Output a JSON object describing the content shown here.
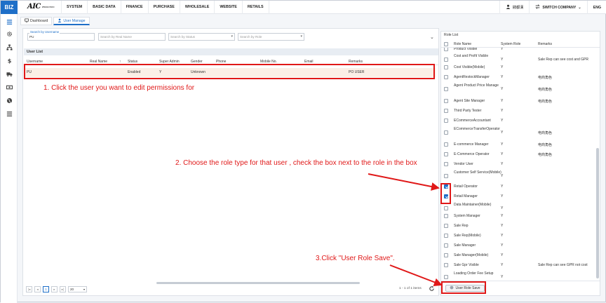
{
  "topbar": {
    "biz": "BIZ",
    "logo": "AIC",
    "logo_sub": "PRODUCTION",
    "menu": [
      "SYSTEM",
      "BASIC DATA",
      "FINANCE",
      "PURCHASE",
      "WHOLESALE",
      "WEBSITE",
      "RETAILS"
    ],
    "user_name": "錢都漢",
    "switch_company": "SWITCH COMPANY",
    "language": "ENG"
  },
  "tabs": [
    "Dashboard",
    "User Manage"
  ],
  "filters": {
    "username_label": "Search by Username",
    "username_value": "PU",
    "real_name_placeholder": "Search by Real Name",
    "status_placeholder": "Search by Status",
    "role_placeholder": "Search by Role"
  },
  "user_list": {
    "title": "User List",
    "columns": [
      "Username",
      "Real Name",
      "Status",
      "Super Admin",
      "Gender",
      "Phone",
      "Mobile No.",
      "Email",
      "Remarks"
    ],
    "sort_icon": "↑",
    "rows": [
      {
        "username": "PU",
        "real_name": "",
        "status": "Enabled",
        "super_admin": "Y",
        "gender": "Unknown",
        "phone": "",
        "mobile": "",
        "email": "",
        "remarks": "PO USER"
      }
    ]
  },
  "pagination": {
    "current_page": "1",
    "page_size": "20",
    "info": "1 - 1 of 1 items"
  },
  "role_list": {
    "title": "Role List",
    "columns": [
      "Role Name",
      "System Role",
      "Remarks"
    ],
    "rows": [
      {
        "name": "Product Visible",
        "sys": "Y",
        "remarks": "",
        "checked": false
      },
      {
        "name": "Cost and Profit Visible",
        "sys": "Y",
        "remarks": "Sale Rep can see cost and GPR",
        "checked": false
      },
      {
        "name": "Cost Visible(Mobile)",
        "sys": "Y",
        "remarks": "",
        "checked": false
      },
      {
        "name": "AgentRestockManager",
        "sys": "Y",
        "remarks": "电商角色",
        "checked": false
      },
      {
        "name": "Agent Product Price Manage",
        "sys": "Y",
        "remarks": "电商角色",
        "checked": false
      },
      {
        "name": "Agent Site Manager",
        "sys": "Y",
        "remarks": "电商角色",
        "checked": false
      },
      {
        "name": "Third Party Tester",
        "sys": "Y",
        "remarks": "",
        "checked": false
      },
      {
        "name": "ECommerceAccountant",
        "sys": "Y",
        "remarks": "",
        "checked": false
      },
      {
        "name": "ECommerceTransferOperator",
        "sys": "Y",
        "remarks": "电商角色",
        "checked": false
      },
      {
        "name": "E-commerce Manager",
        "sys": "Y",
        "remarks": "电商角色",
        "checked": false
      },
      {
        "name": "E-Commerce Operator",
        "sys": "Y",
        "remarks": "电商角色",
        "checked": false
      },
      {
        "name": "Vendor User",
        "sys": "Y",
        "remarks": "",
        "checked": false
      },
      {
        "name": "Customer Self Service(Mobile)",
        "sys": "Y",
        "remarks": "",
        "checked": false
      },
      {
        "name": "Retail Operator",
        "sys": "Y",
        "remarks": "",
        "checked": true
      },
      {
        "name": "Retail Manager",
        "sys": "Y",
        "remarks": "",
        "checked": true
      },
      {
        "name": "Data Maintainer(Mobile)",
        "sys": "Y",
        "remarks": "",
        "checked": false
      },
      {
        "name": "System Manager",
        "sys": "Y",
        "remarks": "",
        "checked": false
      },
      {
        "name": "Sale Rep",
        "sys": "Y",
        "remarks": "",
        "checked": false
      },
      {
        "name": "Sale Rep(Mobile)",
        "sys": "Y",
        "remarks": "",
        "checked": false
      },
      {
        "name": "Sale Manager",
        "sys": "Y",
        "remarks": "",
        "checked": false
      },
      {
        "name": "Sale Manager(Mobile)",
        "sys": "Y",
        "remarks": "",
        "checked": false
      },
      {
        "name": "Sale Gpr Visible",
        "sys": "Y",
        "remarks": "Sale Rep can see GPR not cost",
        "checked": false
      },
      {
        "name": "Loading Order Fee Setup",
        "sys": "Y",
        "remarks": "",
        "checked": false
      }
    ],
    "save_label": "User Role Save"
  },
  "annotations": {
    "step1": "1. Click the user you want to edit permissions for",
    "step2": "2. Choose the role type for that user , check the box next to the role in the box",
    "step3": "3.Click \"User Role Save\"."
  },
  "colors": {
    "accent": "#1e6fc8",
    "annotation": "#e01818",
    "selected_row": "#fbefe6"
  }
}
